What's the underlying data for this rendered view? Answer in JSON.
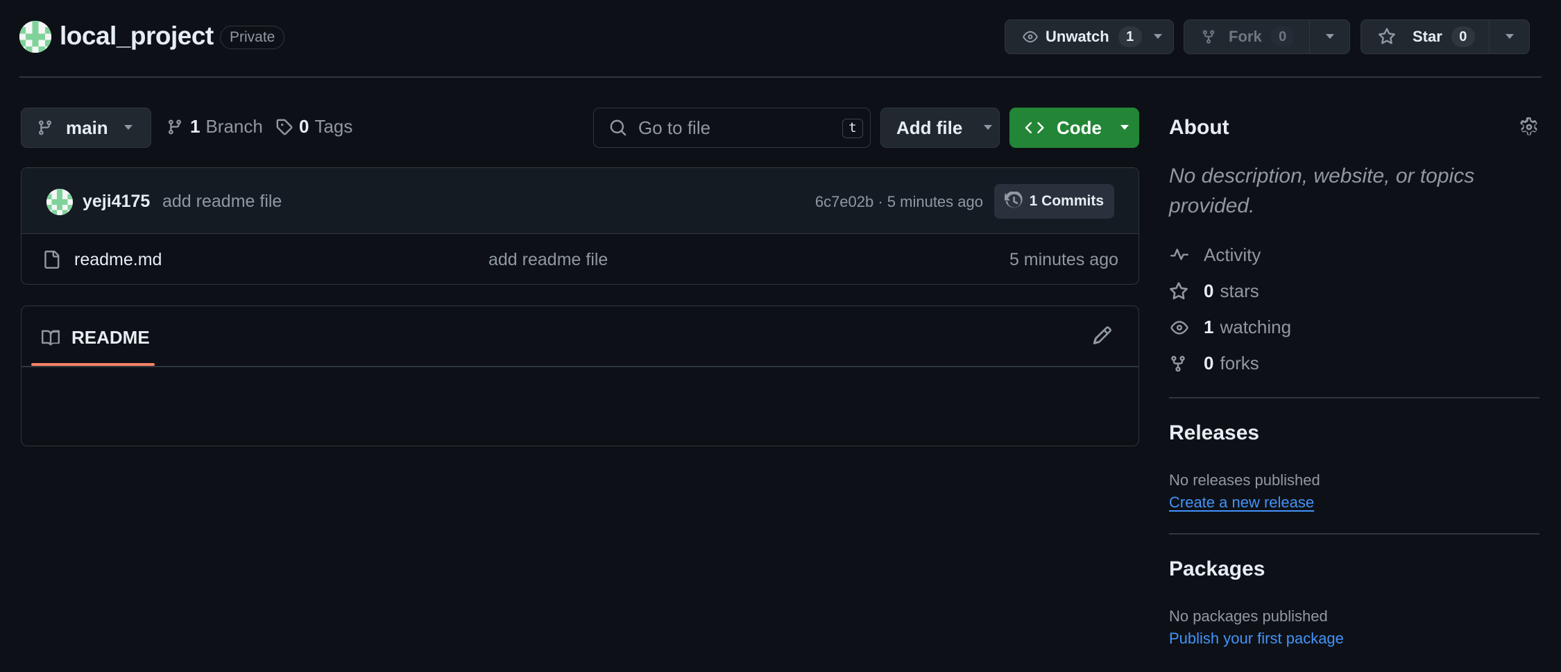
{
  "repo": {
    "name": "local_project",
    "visibility": "Private"
  },
  "actions": {
    "watch_label": "Unwatch",
    "watch_count": "1",
    "fork_label": "Fork",
    "fork_count": "0",
    "star_label": "Star",
    "star_count": "0"
  },
  "toolbar": {
    "branch": "main",
    "branch_count": "1",
    "branch_label": "Branch",
    "tag_count": "0",
    "tag_label": "Tags",
    "search_placeholder": "Go to file",
    "search_shortcut": "t",
    "add_file_label": "Add file",
    "code_label": "Code"
  },
  "latest_commit": {
    "author": "yeji4175",
    "message": "add readme file",
    "meta": "6c7e02b · 5 minutes ago",
    "commits_label": "1 Commits"
  },
  "files": [
    {
      "name": "readme.md",
      "message": "add readme file",
      "time": "5 minutes ago"
    }
  ],
  "readme": {
    "tab_label": "README"
  },
  "sidebar": {
    "about_title": "About",
    "about_description": "No description, website, or topics provided.",
    "activity_label": "Activity",
    "stars_count": "0",
    "stars_label": "stars",
    "watching_count": "1",
    "watching_label": "watching",
    "forks_count": "0",
    "forks_label": "forks",
    "releases_title": "Releases",
    "releases_text": "No releases published",
    "releases_link": "Create a new release",
    "packages_title": "Packages",
    "packages_text": "No packages published",
    "packages_link": "Publish your first package"
  },
  "icons": {
    "eye": "eye-icon",
    "fork": "repo-forked-icon",
    "star": "star-icon",
    "branch": "git-branch-icon",
    "tag": "tag-icon",
    "search": "search-icon",
    "code": "code-icon",
    "history": "history-icon",
    "file": "file-icon",
    "book": "book-icon",
    "pencil": "pencil-icon",
    "gear": "gear-icon",
    "pulse": "pulse-icon",
    "caret": "triangle-down-icon"
  },
  "colors": {
    "background": "#0d1117",
    "border": "#30363d",
    "primary_button": "#238636",
    "accent_underline": "#f78166",
    "link": "#4493f8"
  }
}
